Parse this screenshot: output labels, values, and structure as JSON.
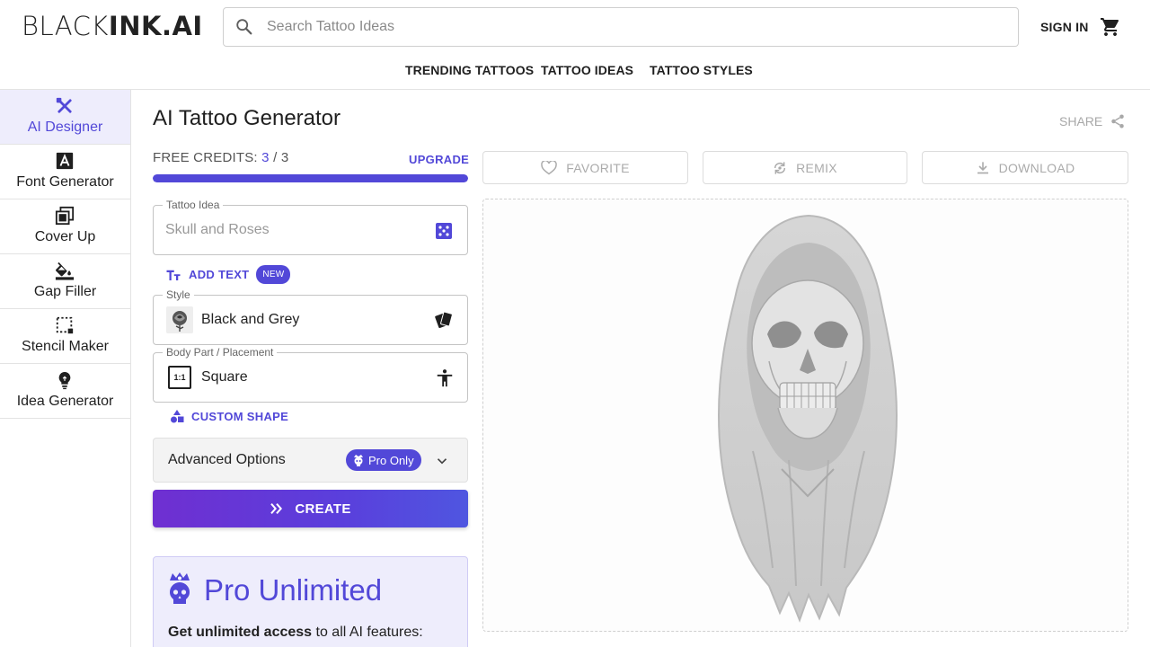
{
  "header": {
    "logo_left": "BLACK",
    "logo_right": "INK.AI",
    "search_placeholder": "Search Tattoo Ideas",
    "sign_in": "SIGN IN",
    "nav": [
      "TRENDING TATTOOS",
      "TATTOO IDEAS",
      "TATTOO STYLES"
    ]
  },
  "sidebar": {
    "items": [
      {
        "label": "AI Designer",
        "icon": "pen-ruler-icon",
        "active": true
      },
      {
        "label": "Font Generator",
        "icon": "font-a-icon"
      },
      {
        "label": "Cover Up",
        "icon": "cover-up-icon"
      },
      {
        "label": "Gap Filler",
        "icon": "paint-bucket-icon"
      },
      {
        "label": "Stencil Maker",
        "icon": "stencil-icon"
      },
      {
        "label": "Idea Generator",
        "icon": "lightbulb-icon"
      }
    ]
  },
  "main": {
    "title": "AI Tattoo Generator",
    "share": "SHARE",
    "credits": {
      "label": "FREE CREDITS:",
      "used": "3",
      "separator": "/",
      "total": "3",
      "fraction": 1.0
    },
    "upgrade": "UPGRADE",
    "tattoo_idea": {
      "label": "Tattoo Idea",
      "placeholder": "Skull and Roses"
    },
    "add_text": "ADD TEXT",
    "new_badge": "NEW",
    "style": {
      "label": "Style",
      "value": "Black and Grey"
    },
    "placement": {
      "label": "Body Part / Placement",
      "value": "Square",
      "ratio": "1:1"
    },
    "custom_shape": "CUSTOM SHAPE",
    "advanced": {
      "label": "Advanced Options",
      "badge": "Pro Only"
    },
    "create": "CREATE",
    "pro": {
      "title": "Pro Unlimited",
      "desc_bold": "Get unlimited access",
      "desc_rest": " to all AI features:"
    }
  },
  "actions": {
    "favorite": "FAVORITE",
    "remix": "REMIX",
    "download": "DOWNLOAD"
  },
  "colors": {
    "accent": "#5248d8",
    "accent_light": "#eeedfc",
    "create_gradient_start": "#6f2fd1",
    "create_gradient_end": "#4f56e0"
  }
}
